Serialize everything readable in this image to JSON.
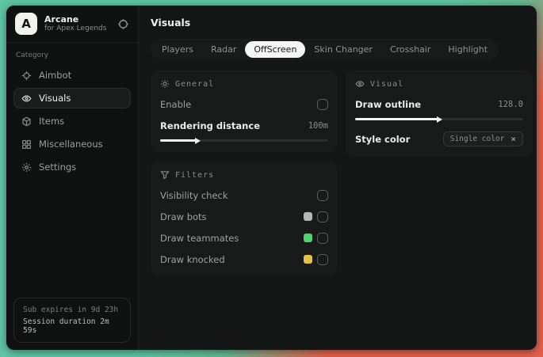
{
  "app": {
    "logo_letter": "A",
    "name": "Arcane",
    "subtitle": "for Apex Legends"
  },
  "sidebar": {
    "category_label": "Category",
    "items": [
      {
        "label": "Aimbot"
      },
      {
        "label": "Visuals"
      },
      {
        "label": "Items"
      },
      {
        "label": "Miscellaneous"
      },
      {
        "label": "Settings"
      }
    ],
    "footer": {
      "line1": "Sub expires in 9d 23h",
      "line2": "Session duration 2m 59s"
    }
  },
  "main": {
    "title": "Visuals",
    "tabs": [
      {
        "label": "Players"
      },
      {
        "label": "Radar"
      },
      {
        "label": "OffScreen"
      },
      {
        "label": "Skin Changer"
      },
      {
        "label": "Crosshair"
      },
      {
        "label": "Highlight"
      }
    ],
    "general": {
      "title": "General",
      "enable_label": "Enable",
      "distance_label": "Rendering distance",
      "distance_value": "100m",
      "distance_fill": "22%"
    },
    "visual": {
      "title": "Visual",
      "outline_label": "Draw outline",
      "outline_value": "128.0",
      "outline_fill": "50%",
      "style_label": "Style color",
      "style_value": "Single color",
      "clear_icon": "×"
    },
    "filters": {
      "title": "Filters",
      "rows": [
        {
          "label": "Visibility check",
          "swatch": ""
        },
        {
          "label": "Draw bots",
          "swatch": "#b4b6b0"
        },
        {
          "label": "Draw teammates",
          "swatch": "#4fd569"
        },
        {
          "label": "Draw knocked",
          "swatch": "#e2c247"
        }
      ]
    }
  },
  "colors": {
    "backdrop_teal": "#5fc4a4",
    "backdrop_red": "#e0604b",
    "swatch_bots": "#b4b6b0",
    "swatch_teammates": "#4fd569",
    "swatch_knocked": "#e2c247"
  }
}
